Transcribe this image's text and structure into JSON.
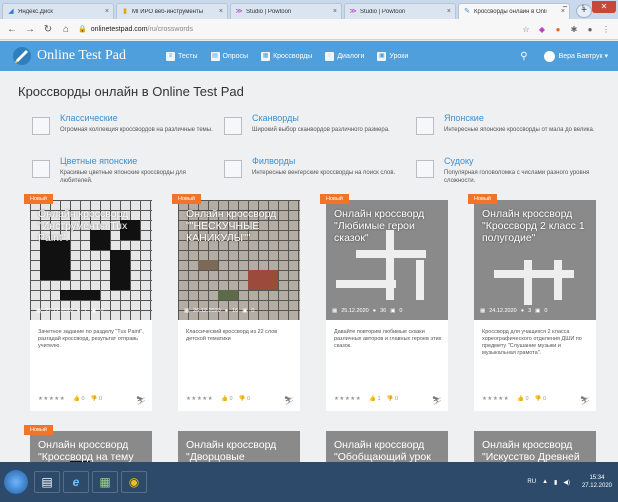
{
  "browser": {
    "tabs": [
      {
        "label": "Яндекс.Диск",
        "favicon": "yandex-disk-icon"
      },
      {
        "label": "МГИРО веб-инструменты",
        "favicon": "bookmark-icon"
      },
      {
        "label": "Studio | Powtoon",
        "favicon": "powtoon-icon"
      },
      {
        "label": "Studio | Powtoon",
        "favicon": "powtoon-icon"
      },
      {
        "label": "Кроссворды онлайн в Onli",
        "favicon": "testpad-icon",
        "active": true
      }
    ],
    "url_host": "onlinetestpad.com",
    "url_path": "/ru/crosswords"
  },
  "header": {
    "brand": "Online Test Pad",
    "menu": [
      "Тесты",
      "Опросы",
      "Кроссворды",
      "Диалоги",
      "Уроки"
    ],
    "user": "Вера Бавтрук"
  },
  "page": {
    "title": "Кроссворды онлайн в Online Test Pad",
    "categories": [
      {
        "name": "Классические",
        "desc": "Огромная коллекция кроссвордов на различные темы."
      },
      {
        "name": "Сканворды",
        "desc": "Широкий выбор сканвордов различного размера."
      },
      {
        "name": "Японские",
        "desc": "Интересные японские кроссворды от мала до велика."
      },
      {
        "name": "Цветные японские",
        "desc": "Красивые цветные японские кроссворды для любителей."
      },
      {
        "name": "Филворды",
        "desc": "Интересные венгерские кроссворды на поиск слов."
      },
      {
        "name": "Судоку",
        "desc": "Популярная головоломка с числами разного уровня сложности."
      }
    ],
    "badge": "Новый",
    "cards": [
      {
        "title": "Онлайн кроссворд \"Инструменты Tux Paint\".",
        "date": "27.12.2020",
        "users": "1",
        "comments": "0",
        "desc": "Зачетное задание по разделу \"Tux Paint\", разгадай кроссворд, результат отправь учителю.",
        "stars": "★★★★★",
        "likes": "0",
        "dislikes": "0"
      },
      {
        "title": "Онлайн кроссворд \"\"НЕСКУЧНЫЕ КАНИКУЛЫ\"\"",
        "date": "26.12.2020",
        "users": "16",
        "comments": "0",
        "desc": "Классический кроссворд из 22 слов детской тематики",
        "stars": "★★★★★",
        "likes": "0",
        "dislikes": "0"
      },
      {
        "title": "Онлайн кроссворд \"Любимые герои сказок\"",
        "date": "25.12.2020",
        "users": "36",
        "comments": "0",
        "desc": "Давайте повторим любимые сказки различных авторов и главных героев этих сказок.",
        "stars": "★★★★★",
        "likes": "1",
        "dislikes": "0"
      },
      {
        "title": "Онлайн кроссворд \"Кроссворд 2 класс 1 полугодие\"",
        "date": "24.12.2020",
        "users": "3",
        "comments": "0",
        "desc": "Кроссворд для учащихся 2 класса хореографического отделения ДШИ по предмету \"Слушание музыки и музыкальная грамота\".",
        "stars": "★★★★★",
        "likes": "0",
        "dislikes": "0"
      }
    ],
    "cards_row2": [
      {
        "title": "Онлайн кроссворд \"Кроссворд на тему",
        "badge": true
      },
      {
        "title": "Онлайн кроссворд \"Дворцовые перевороты\"",
        "badge": false
      },
      {
        "title": "Онлайн кроссворд \"Обобщающий урок по теме",
        "badge": false
      },
      {
        "title": "Онлайн кроссворд \"Искусство Древней Руси\"",
        "badge": false
      }
    ]
  },
  "taskbar": {
    "lang": "RU",
    "time": "15:34",
    "date": "27.12.2020"
  },
  "colors": {
    "header_blue": "#4e9fdb",
    "badge_orange": "#f0742a",
    "link_blue": "#3d8fd0"
  }
}
